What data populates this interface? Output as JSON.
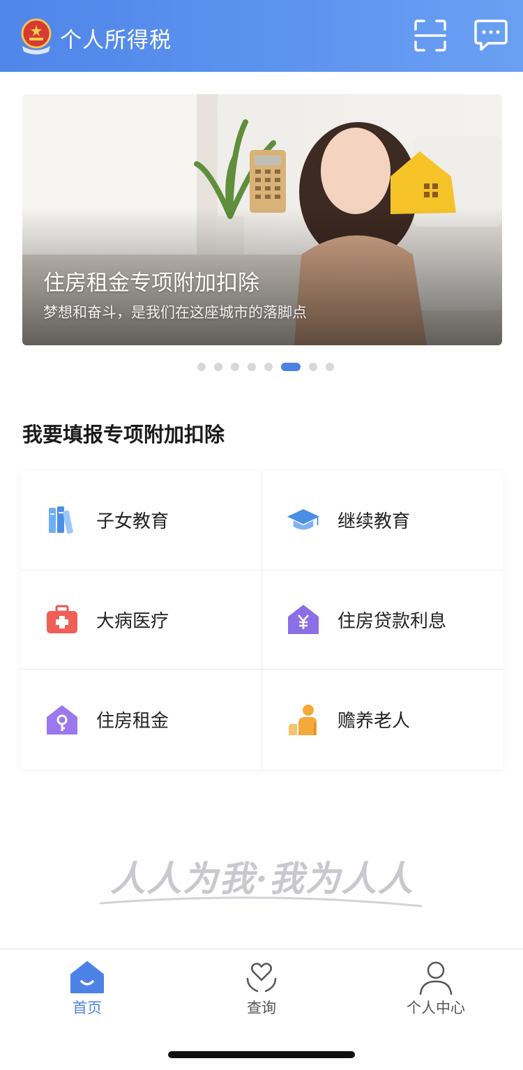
{
  "header": {
    "title": "个人所得税",
    "emblem_icon": "national-emblem-icon",
    "scan_icon": "scan-icon",
    "message_icon": "message-icon",
    "gradient_start": "#4f86e8",
    "gradient_end": "#6aa0f2"
  },
  "banner": {
    "title": "住房租金专项附加扣除",
    "subtitle": "梦想和奋斗，是我们在这座城市的落脚点",
    "carousel": {
      "total": 8,
      "active_index": 5
    }
  },
  "section": {
    "title": "我要填报专项附加扣除"
  },
  "deductions": [
    {
      "label": "子女教育",
      "icon": "books-icon",
      "color": "#5b9ef0"
    },
    {
      "label": "继续教育",
      "icon": "graduation-cap-icon",
      "color": "#4c8ee6"
    },
    {
      "label": "大病医疗",
      "icon": "medical-kit-icon",
      "color": "#ef5f55"
    },
    {
      "label": "住房贷款利息",
      "icon": "house-yuan-icon",
      "color": "#8c6fe6"
    },
    {
      "label": "住房租金",
      "icon": "house-key-icon",
      "color": "#9b78ee"
    },
    {
      "label": "赡养老人",
      "icon": "elderly-care-icon",
      "color": "#f4a93a"
    }
  ],
  "slogan": {
    "text": "人人为我·我为人人"
  },
  "tabbar": {
    "items": [
      {
        "label": "首页",
        "icon": "home-icon",
        "active": true
      },
      {
        "label": "查询",
        "icon": "heart-hands-icon",
        "active": false
      },
      {
        "label": "个人中心",
        "icon": "person-icon",
        "active": false
      }
    ],
    "active_color": "#4c82e6"
  }
}
